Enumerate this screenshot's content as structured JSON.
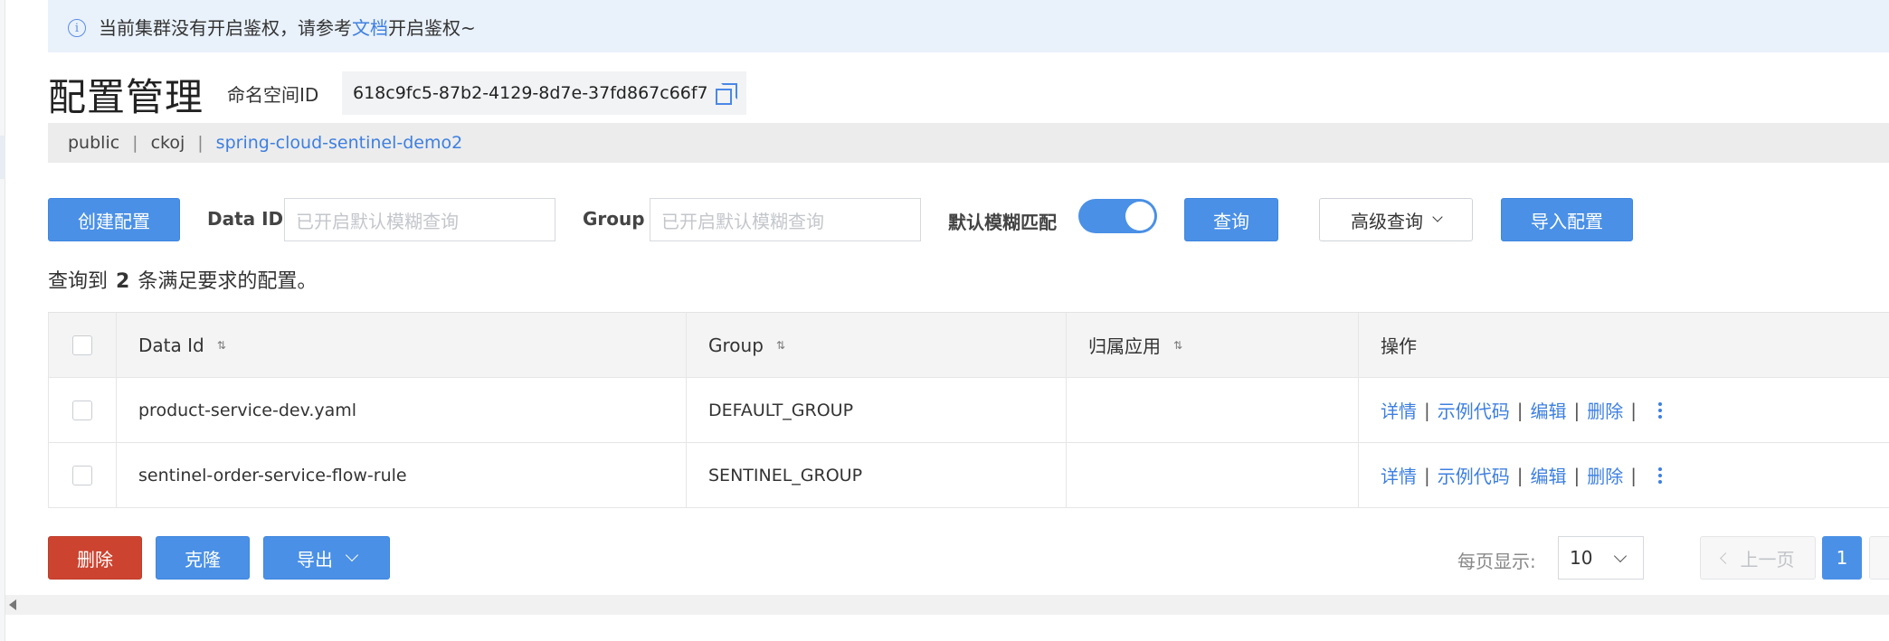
{
  "notice": {
    "text_before": "当前集群没有开启鉴权，请参考",
    "link": "文档",
    "text_after": "开启鉴权~"
  },
  "header": {
    "title": "配置管理",
    "namespace_label": "命名空间ID",
    "namespace_id": "618c9fc5-87b2-4129-8d7e-37fd867c66f7"
  },
  "namespaces": [
    {
      "label": "public",
      "active": false
    },
    {
      "label": "ckoj",
      "active": false
    },
    {
      "label": "spring-cloud-sentinel-demo2",
      "active": true
    }
  ],
  "namespace_separator": "|",
  "toolbar": {
    "create_label": "创建配置",
    "data_id_label": "Data ID",
    "data_id_placeholder": "已开启默认模糊查询",
    "group_label": "Group",
    "group_placeholder": "已开启默认模糊查询",
    "fuzzy_label": "默认模糊匹配",
    "fuzzy_on": true,
    "query_label": "查询",
    "advanced_label": "高级查询",
    "import_label": "导入配置"
  },
  "summary": {
    "prefix": "查询到",
    "count": "2",
    "suffix": "条满足要求的配置。"
  },
  "table": {
    "columns": [
      "Data Id",
      "Group",
      "归属应用",
      "操作"
    ],
    "sort_icon": "⇅",
    "rows": [
      {
        "data_id": "product-service-dev.yaml",
        "group": "DEFAULT_GROUP",
        "app": ""
      },
      {
        "data_id": "sentinel-order-service-flow-rule",
        "group": "SENTINEL_GROUP",
        "app": ""
      }
    ],
    "actions": [
      "详情",
      "示例代码",
      "编辑",
      "删除"
    ],
    "action_separator": "|"
  },
  "footer": {
    "delete_label": "删除",
    "clone_label": "克隆",
    "export_label": "导出",
    "page_size_label": "每页显示:",
    "page_size": "10",
    "prev_label": "上一页",
    "current_page": "1"
  },
  "colors": {
    "primary": "#4a90e6",
    "danger": "#cc4430",
    "link": "#3d7fe0",
    "notice_bg": "#e9f1fb"
  }
}
